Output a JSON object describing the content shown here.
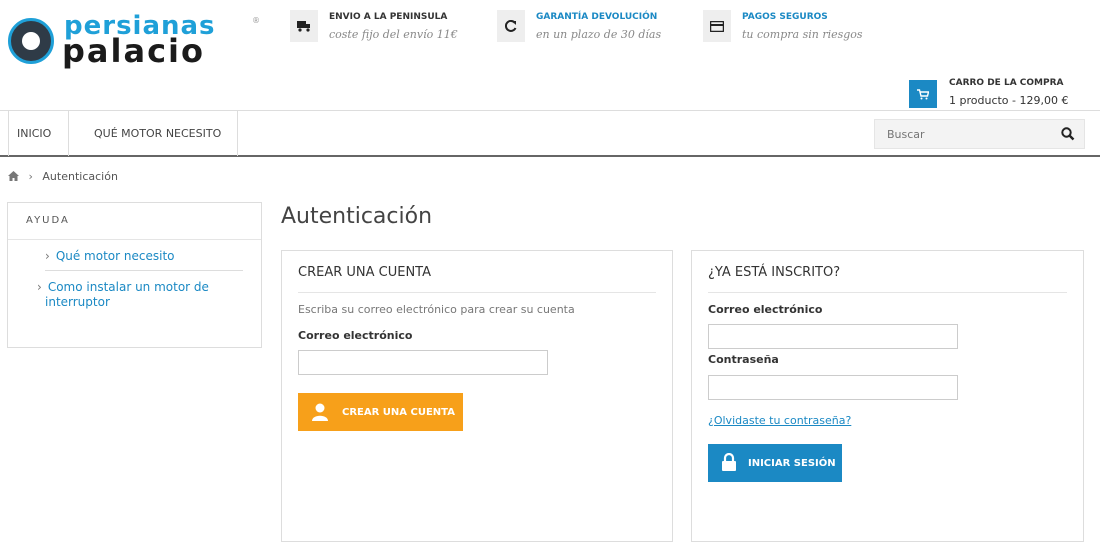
{
  "logo": {
    "line1": "persianas",
    "line2": "palacio",
    "mark": "®"
  },
  "features": [
    {
      "icon": "truck-icon",
      "title": "ENVIO A LA PENINSULA",
      "subtitle": "coste fijo del envío 11€",
      "title_color": "#333333"
    },
    {
      "icon": "refresh-icon",
      "title": "GARANTÍA DEVOLUCIÓN",
      "subtitle": "en un plazo de 30 días",
      "title_color": "#1b89c4"
    },
    {
      "icon": "credit-card-icon",
      "title": "PAGOS SEGUROS",
      "subtitle": "tu compra sin riesgos",
      "title_color": "#1b89c4"
    }
  ],
  "cart": {
    "title": "CARRO DE LA COMPRA",
    "summary": "1 producto - 129,00 €"
  },
  "nav": {
    "items": [
      "INICIO",
      "QUÉ MOTOR NECESITO"
    ]
  },
  "search": {
    "placeholder": "Buscar"
  },
  "breadcrumb": {
    "current": "Autenticación"
  },
  "sidebar": {
    "title": "AYUDA",
    "items": [
      "Qué motor necesito",
      "Como instalar un motor de interruptor"
    ]
  },
  "page": {
    "title": "Autenticación"
  },
  "create_account": {
    "heading": "CREAR UNA CUENTA",
    "description": "Escriba su correo electrónico para crear su cuenta",
    "email_label": "Correo electrónico",
    "email_value": "",
    "button": "CREAR UNA CUENTA"
  },
  "login": {
    "heading": "¿YA ESTÁ INSCRITO?",
    "email_label": "Correo electrónico",
    "email_value": "",
    "password_label": "Contraseña",
    "password_value": "",
    "forgot": "¿Olvidaste tu contraseña?",
    "button": "INICIAR SESIÓN"
  },
  "colors": {
    "accent": "#1b89c4",
    "orange": "#f7a01a",
    "logo_blue": "#1fa0d8"
  }
}
